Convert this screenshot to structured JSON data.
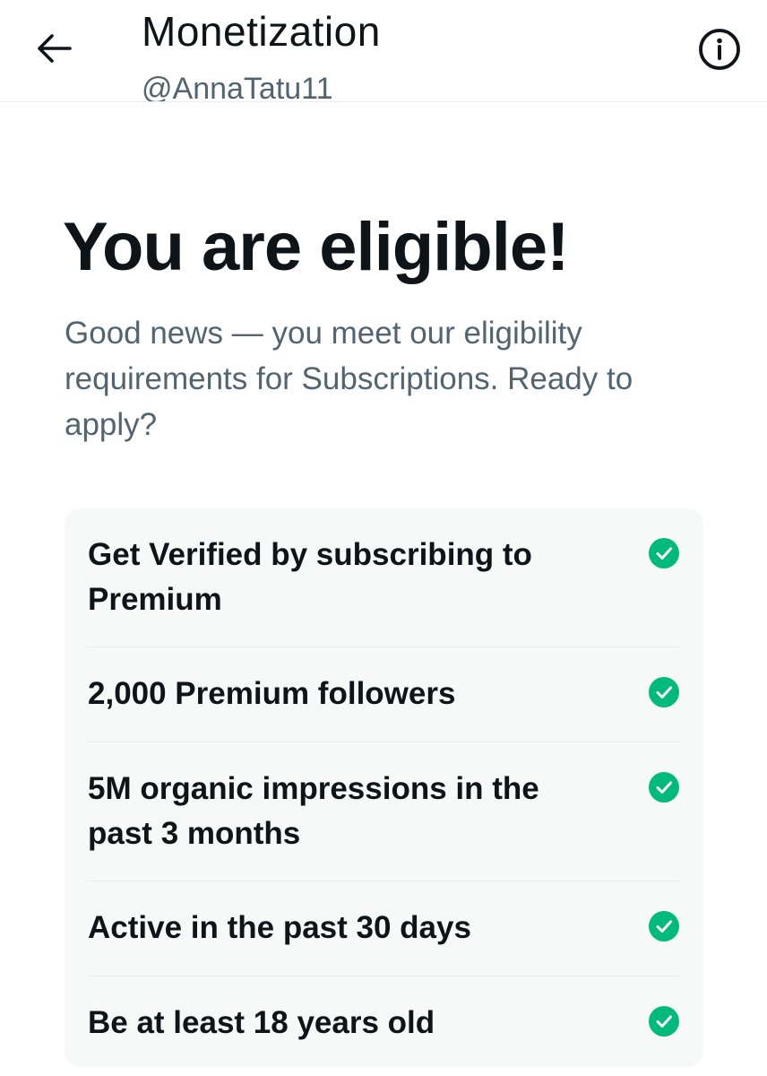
{
  "header": {
    "title": "Monetization",
    "handle": "@AnnaTatu11",
    "back_icon": "arrow-left-icon",
    "info_icon": "info-circle-icon"
  },
  "main": {
    "title": "You are eligible!",
    "subtitle": "Good news — you meet our eligibility requirements for Subscriptions. Ready to apply?"
  },
  "requirements": [
    {
      "label": "Get Verified by subscribing to Premium",
      "met": true
    },
    {
      "label": "2,000 Premium followers",
      "met": true
    },
    {
      "label": "5M organic impressions in the past 3 months",
      "met": true
    },
    {
      "label": "Active in the past 30 days",
      "met": true
    },
    {
      "label": "Be at least 18 years old",
      "met": true
    }
  ],
  "colors": {
    "accent_green": "#00ba7c",
    "text_primary": "#0f1419",
    "text_secondary": "#536471",
    "card_bg": "#f7f9f9"
  }
}
